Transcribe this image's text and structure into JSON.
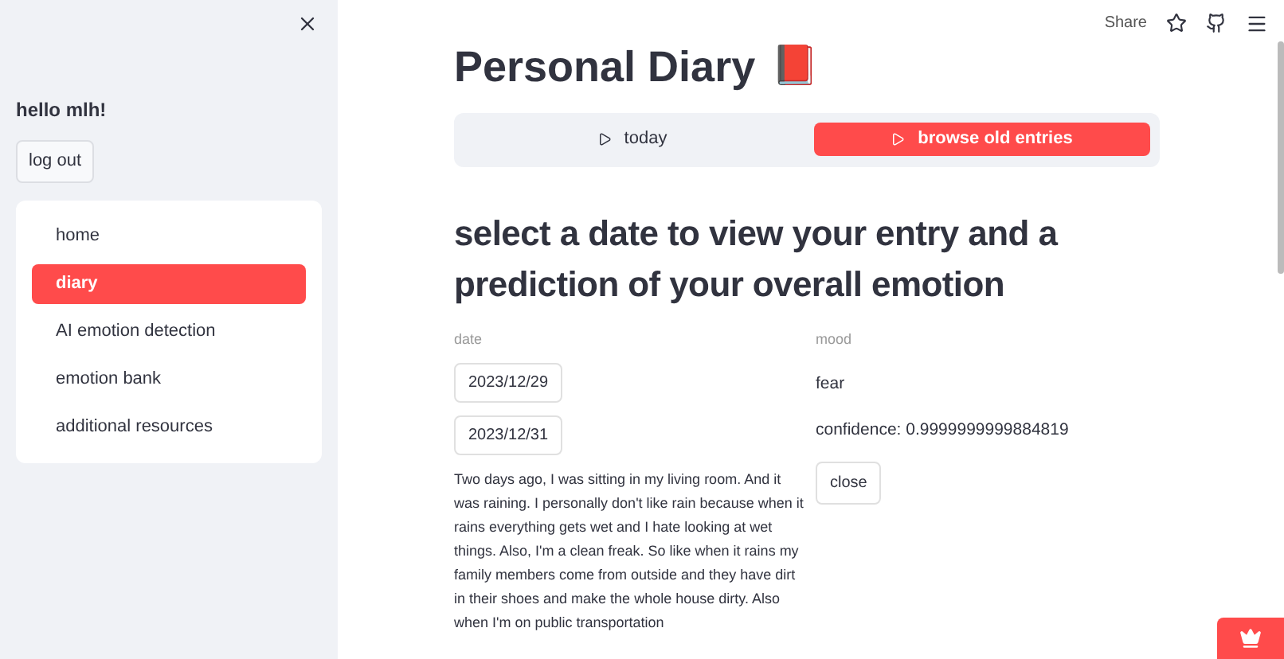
{
  "sidebar": {
    "greeting": "hello mlh!",
    "logout_button": "log out",
    "nav_items": [
      {
        "label": "home",
        "selected": false
      },
      {
        "label": "diary",
        "selected": true
      },
      {
        "label": "AI emotion detection",
        "selected": false
      },
      {
        "label": "emotion bank",
        "selected": false
      },
      {
        "label": "additional resources",
        "selected": false
      }
    ]
  },
  "toolbar": {
    "share": "Share"
  },
  "title": "Personal Diary",
  "title_emoji": "📕",
  "tabs": [
    {
      "label": "today",
      "selected": false
    },
    {
      "label": "browse old entries",
      "selected": true
    }
  ],
  "heading": "select a date to view your entry and a prediction of your overall emotion",
  "date_column": {
    "label": "date",
    "dates": [
      "2023/12/29",
      "2023/12/31"
    ],
    "entry": "Two days ago, I was sitting in my living room. And it was raining. I personally don't like rain because when it rains everything gets wet and I hate looking at wet things. Also, I'm a clean freak. So like when it rains my family members come from outside and they have dirt in their shoes and make the whole house dirty. Also when I'm on public transportation"
  },
  "mood_column": {
    "label": "mood",
    "mood": "fear",
    "confidence": "confidence: 0.9999999999884819",
    "close_button": "close"
  }
}
